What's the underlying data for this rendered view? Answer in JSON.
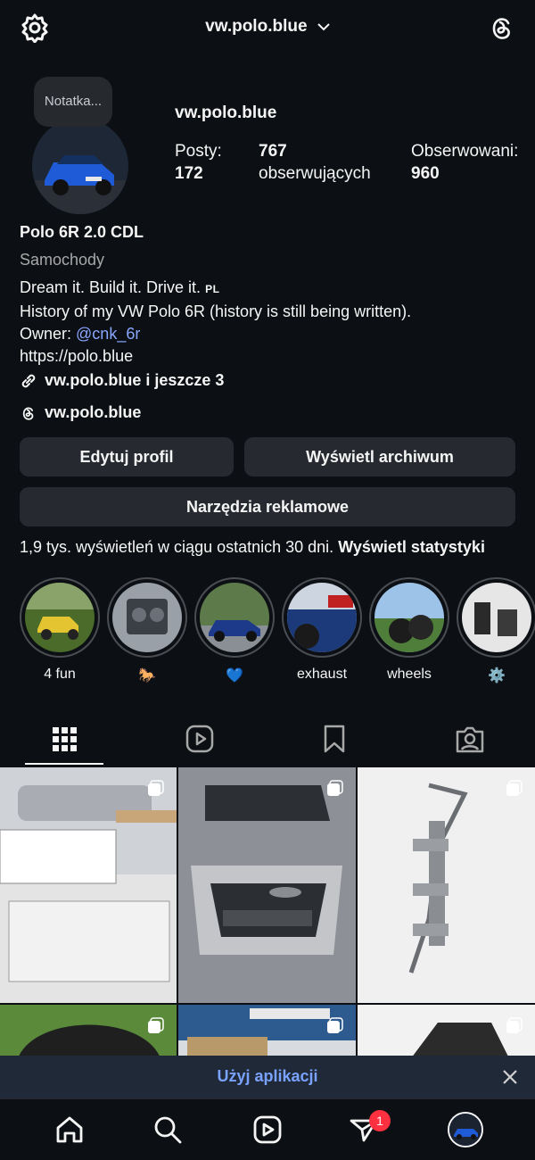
{
  "header": {
    "username": "vw.polo.blue"
  },
  "note": {
    "label": "Notatka..."
  },
  "profile": {
    "username": "vw.polo.blue",
    "stats": {
      "posts_label": "Posty:",
      "posts_value": "172",
      "followers_value": "767",
      "followers_label": "obserwujących",
      "following_label": "Obserwowani:",
      "following_value": "960"
    }
  },
  "bio": {
    "name": "Polo 6R 2.0 CDL",
    "category": "Samochody",
    "line1": "Dream it. Build it. Drive it.",
    "line1_tag": "PL",
    "line2": "History of my VW Polo 6R (history is still being written).",
    "owner_prefix": "Owner: ",
    "owner_mention": "@cnk_6r",
    "website": "https://polo.blue",
    "links_label": "vw.polo.blue i jeszcze 3",
    "threads_label": "vw.polo.blue"
  },
  "buttons": {
    "edit_profile": "Edytuj profil",
    "view_archive": "Wyświetl archiwum",
    "ad_tools": "Narzędzia reklamowe"
  },
  "insights": {
    "text": "1,9 tys. wyświetleń w ciągu ostatnich 30 dni.",
    "link": "Wyświetl statystyki"
  },
  "highlights": [
    {
      "label": "4 fun"
    },
    {
      "label": "🐎"
    },
    {
      "label": "💙"
    },
    {
      "label": "exhaust"
    },
    {
      "label": "wheels"
    },
    {
      "label": "⚙️"
    }
  ],
  "tabs": [
    "grid-icon",
    "reels-icon",
    "saved-icon",
    "tagged-icon"
  ],
  "app_banner": {
    "label": "Użyj aplikacji"
  },
  "bottom_nav": {
    "notifications_badge": "1"
  },
  "colors": {
    "background": "#0c1014",
    "button": "#262a30",
    "mention": "#8aa6ff",
    "banner_text": "#7aa2ff",
    "badge": "#ff3040"
  }
}
